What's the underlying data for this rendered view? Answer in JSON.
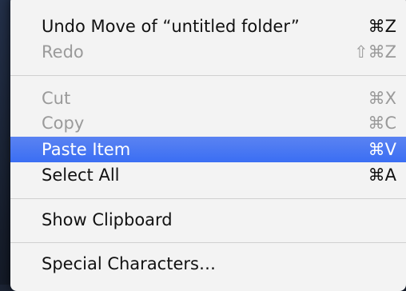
{
  "menu": {
    "items": [
      {
        "label": "Undo Move of “untitled folder”",
        "shortcut": "⌘Z",
        "state": "enabled"
      },
      {
        "label": "Redo",
        "shortcut": "⇧⌘Z",
        "state": "disabled"
      },
      {
        "label": "Cut",
        "shortcut": "⌘X",
        "state": "disabled"
      },
      {
        "label": "Copy",
        "shortcut": "⌘C",
        "state": "disabled"
      },
      {
        "label": "Paste Item",
        "shortcut": "⌘V",
        "state": "highlighted"
      },
      {
        "label": "Select All",
        "shortcut": "⌘A",
        "state": "enabled"
      },
      {
        "label": "Show Clipboard",
        "shortcut": "",
        "state": "enabled"
      },
      {
        "label": "Special Characters…",
        "shortcut": "",
        "state": "enabled"
      }
    ]
  },
  "colors": {
    "highlight": "#3b6ef3",
    "menu_background": "#f3f3f3",
    "disabled_text": "#9a9a9a",
    "backdrop": "#1b2333"
  }
}
